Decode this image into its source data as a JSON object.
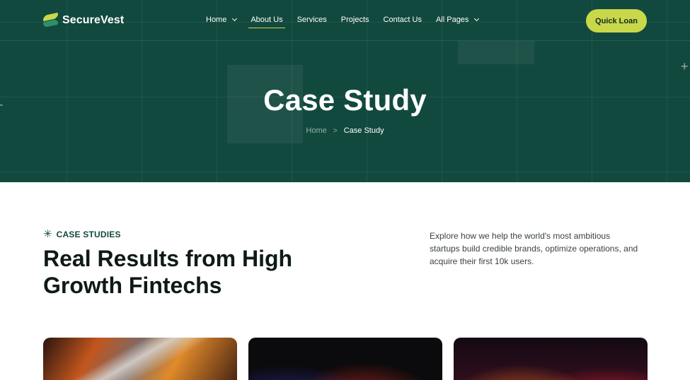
{
  "brand": {
    "name": "SecureVest"
  },
  "nav": {
    "items": [
      {
        "label": "Home",
        "dropdown": true,
        "active": false
      },
      {
        "label": "About Us",
        "dropdown": false,
        "active": true
      },
      {
        "label": "Services",
        "dropdown": false,
        "active": false
      },
      {
        "label": "Projects",
        "dropdown": false,
        "active": false
      },
      {
        "label": "Contact Us",
        "dropdown": false,
        "active": false
      },
      {
        "label": "All Pages",
        "dropdown": true,
        "active": false
      }
    ],
    "cta_label": "Quick Loan"
  },
  "hero": {
    "title": "Case Study",
    "breadcrumb": {
      "home": "Home",
      "separator": ">",
      "current": "Case Study"
    }
  },
  "section": {
    "eyebrow": "CASE STUDIES",
    "eyebrow_icon": "asterisk-icon",
    "title": "Real Results from High Growth Fintechs",
    "description": "Explore how we help the world's most ambitious startups build credible brands, optimize operations, and acquire their first 10k users."
  },
  "colors": {
    "hero_bg": "#12493f",
    "accent": "#c9d84a",
    "text_dark": "#0f1a17"
  },
  "cards": [
    {
      "name": "case-study-card-1"
    },
    {
      "name": "case-study-card-2"
    },
    {
      "name": "case-study-card-3"
    }
  ]
}
